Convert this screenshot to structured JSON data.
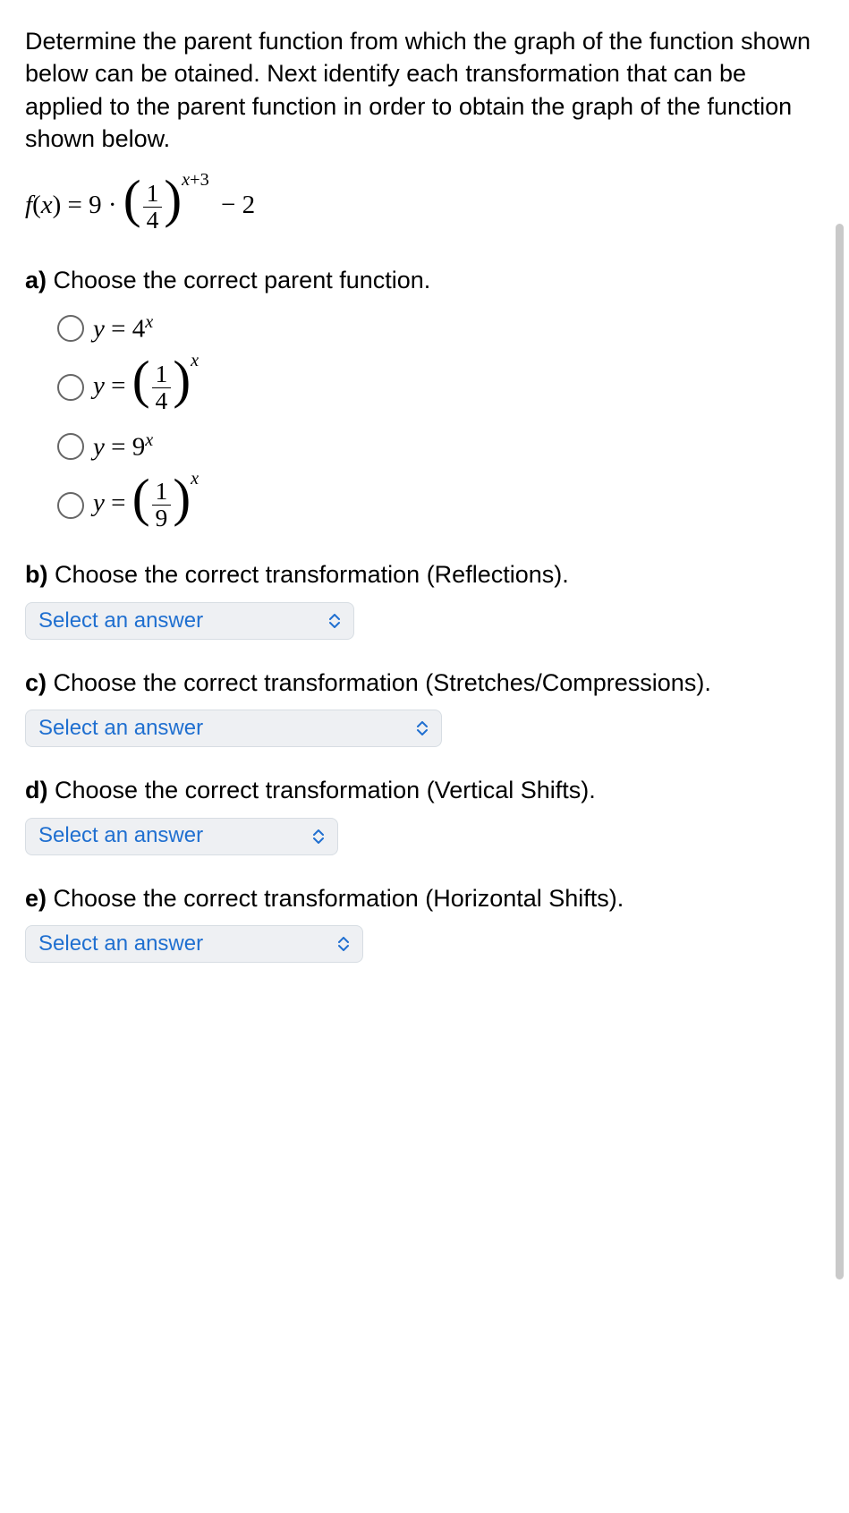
{
  "intro": "Determine the parent function from which the graph of the function shown below can be otained. Next identify each transformation that can be applied to the parent function in order to obtain the graph of the function shown below.",
  "formula": {
    "lhs": "f(x) = 9 ·",
    "frac_num": "1",
    "frac_den": "4",
    "exp": "x+3",
    "tail": "− 2"
  },
  "parts": {
    "a": {
      "letter": "a)",
      "text": "Choose the correct parent function.",
      "options": {
        "o1": {
          "pre": "y = 4",
          "sup": "x"
        },
        "o2": {
          "pre": "y =",
          "frac_num": "1",
          "frac_den": "4",
          "sup": "x"
        },
        "o3": {
          "pre": "y = 9",
          "sup": "x"
        },
        "o4": {
          "pre": "y =",
          "frac_num": "1",
          "frac_den": "9",
          "sup": "x"
        }
      }
    },
    "b": {
      "letter": "b)",
      "text": "Choose the correct transformation (Reflections).",
      "select": "Select an answer"
    },
    "c": {
      "letter": "c)",
      "text": "Choose the correct transformation (Stretches/Compressions).",
      "select": "Select an answer"
    },
    "d": {
      "letter": "d)",
      "text": "Choose the correct transformation (Vertical Shifts).",
      "select": "Select an answer"
    },
    "e": {
      "letter": "e)",
      "text": "Choose the correct transformation (Horizontal Shifts).",
      "select": "Select an answer"
    }
  }
}
